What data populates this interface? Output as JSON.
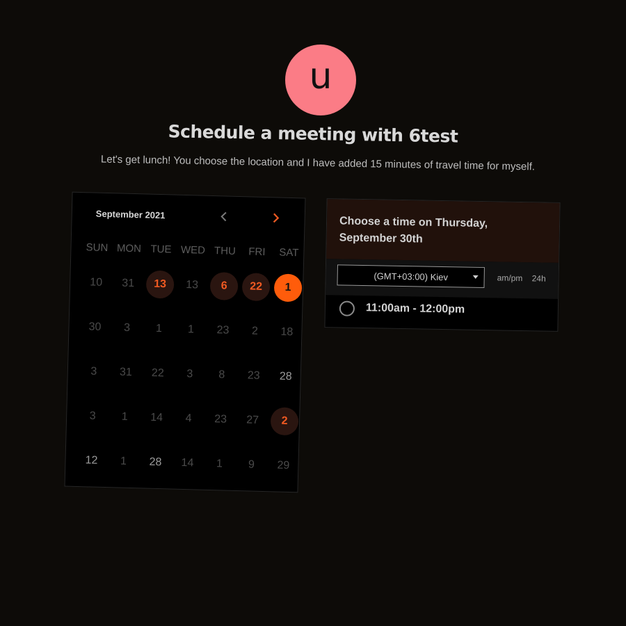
{
  "profile": {
    "initial": "u",
    "avatar_color": "#fb7c86"
  },
  "header": {
    "title": "Schedule a meeting with 6test",
    "subtitle": "Let's get lunch! You choose the location and I have added 15 minutes of travel time for myself."
  },
  "calendar": {
    "month": "September 2021",
    "prev_icon": "chevron-left-icon",
    "next_icon": "chevron-right-icon",
    "weekdays": [
      "SUN",
      "MON",
      "TUE",
      "WED",
      "THU",
      "FRI",
      "SAT"
    ],
    "days": [
      {
        "label": "10",
        "state": "dim"
      },
      {
        "label": "31",
        "state": "dim"
      },
      {
        "label": "13",
        "state": "available"
      },
      {
        "label": "13",
        "state": "dim"
      },
      {
        "label": "6",
        "state": "available"
      },
      {
        "label": "22",
        "state": "available"
      },
      {
        "label": "1",
        "state": "selected"
      },
      {
        "label": "30",
        "state": "dim"
      },
      {
        "label": "3",
        "state": "dim"
      },
      {
        "label": "1",
        "state": "dim"
      },
      {
        "label": "1",
        "state": "dim"
      },
      {
        "label": "23",
        "state": "dim"
      },
      {
        "label": "2",
        "state": "dim"
      },
      {
        "label": "18",
        "state": "dim"
      },
      {
        "label": "3",
        "state": "dim"
      },
      {
        "label": "31",
        "state": "dim"
      },
      {
        "label": "22",
        "state": "dim"
      },
      {
        "label": "3",
        "state": "dim"
      },
      {
        "label": "8",
        "state": "dim"
      },
      {
        "label": "23",
        "state": "dim"
      },
      {
        "label": "28",
        "state": "bright"
      },
      {
        "label": "3",
        "state": "dim"
      },
      {
        "label": "1",
        "state": "dim"
      },
      {
        "label": "14",
        "state": "dim"
      },
      {
        "label": "4",
        "state": "dim"
      },
      {
        "label": "23",
        "state": "dim"
      },
      {
        "label": "27",
        "state": "dim"
      },
      {
        "label": "2",
        "state": "available"
      },
      {
        "label": "12",
        "state": "bright"
      },
      {
        "label": "1",
        "state": "dim"
      },
      {
        "label": "28",
        "state": "bright"
      },
      {
        "label": "14",
        "state": "dim"
      },
      {
        "label": "1",
        "state": "dim"
      },
      {
        "label": "9",
        "state": "dim"
      },
      {
        "label": "29",
        "state": "dim"
      }
    ],
    "accent": "#ff5c0b"
  },
  "times": {
    "heading": "Choose a time on Thursday, September 30th",
    "timezone": "(GMT+03:00) Kiev",
    "format_ampm": "am/pm",
    "format_24h": "24h",
    "slots": [
      {
        "label": "11:00am - 12:00pm"
      }
    ]
  }
}
